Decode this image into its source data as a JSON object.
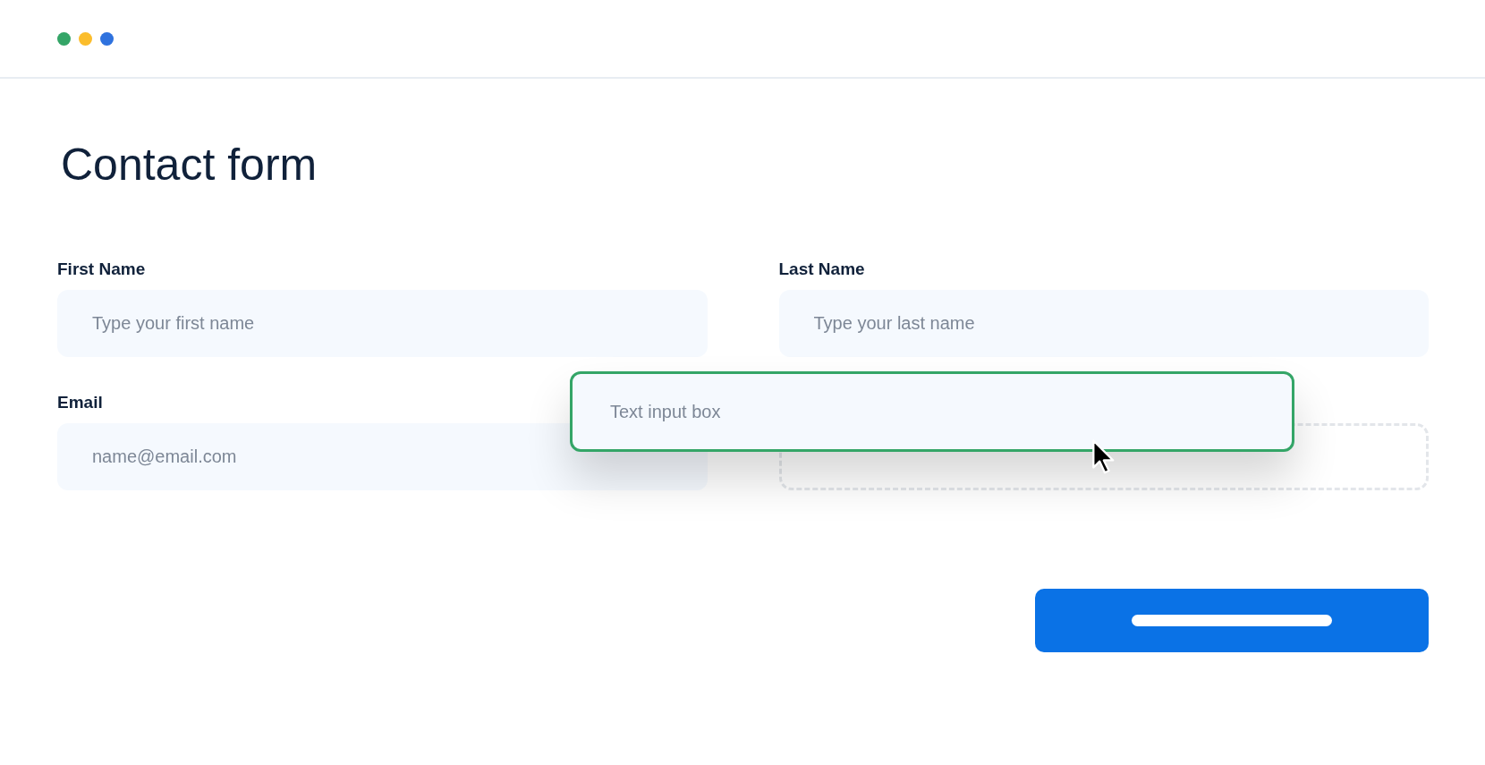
{
  "window": {
    "dots": [
      {
        "color": "#34a567"
      },
      {
        "color": "#fbbd2c"
      },
      {
        "color": "#2f72de"
      }
    ]
  },
  "title": "Contact form",
  "fields": [
    {
      "kind": "input",
      "label": "First Name",
      "placeholder": "Type your first name"
    },
    {
      "kind": "input",
      "label": "Last Name",
      "placeholder": "Type your last name"
    },
    {
      "kind": "input",
      "label": "Email",
      "placeholder": "name@email.com"
    },
    {
      "kind": "drop-slot"
    }
  ],
  "dragged_field": {
    "placeholder": "Text input box"
  }
}
